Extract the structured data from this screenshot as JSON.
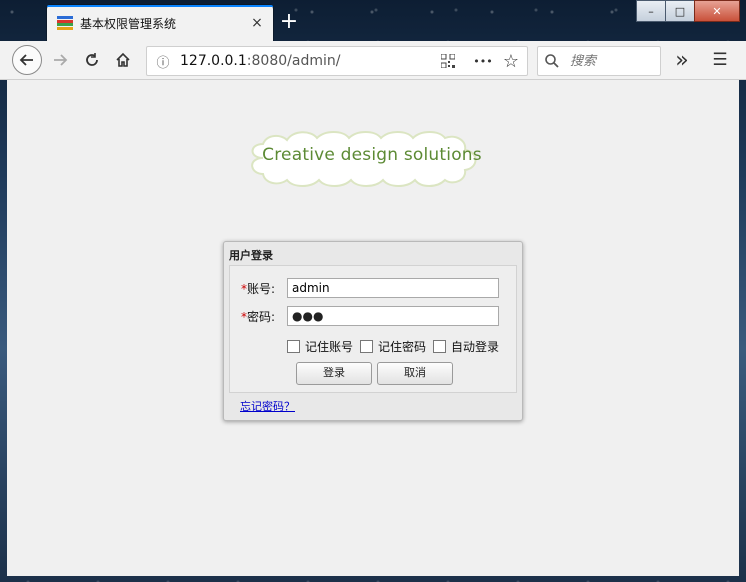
{
  "browser": {
    "tab_title": "基本权限管理系统",
    "tab_close": "×",
    "new_tab": "+",
    "url_host": "127.0.0.1",
    "url_rest": ":8080/admin/",
    "search_placeholder": "搜索",
    "overflow": "»",
    "menu": "☰",
    "page_actions": "•••",
    "info_icon": "ⓘ",
    "star_icon": "☆"
  },
  "window_controls": {
    "minimize": "–",
    "maximize": "□",
    "close": "✕"
  },
  "page": {
    "banner_text": "Creative design solutions",
    "login": {
      "title": "用户登录",
      "required_mark": "*",
      "username_label": "账号:",
      "username_value": "admin",
      "password_label": "密码:",
      "password_value": "●●●",
      "remember_account": "记住账号",
      "remember_password": "记住密码",
      "auto_login": "自动登录",
      "login_button": "登录",
      "cancel_button": "取消",
      "forgot_link": "忘记密码？"
    }
  },
  "colors": {
    "accent": "#0a84ff",
    "banner_green": "#5c8a34",
    "required": "#cc0000",
    "link": "#0000cc"
  }
}
